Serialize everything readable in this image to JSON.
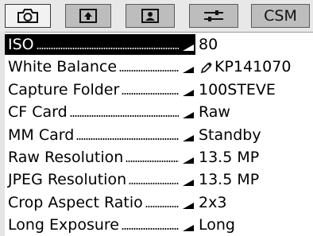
{
  "tabs": [
    {
      "name": "tab-camera",
      "icon": "camera-icon",
      "label": "",
      "active": true
    },
    {
      "name": "tab-upload",
      "icon": "upload-icon",
      "label": "",
      "active": false
    },
    {
      "name": "tab-person",
      "icon": "person-icon",
      "label": "",
      "active": false
    },
    {
      "name": "tab-settings",
      "icon": "sliders-icon",
      "label": "",
      "active": false
    },
    {
      "name": "tab-csm",
      "icon": "",
      "label": "CSM",
      "active": false
    }
  ],
  "menu": {
    "items": [
      {
        "label": "ISO",
        "value": "80",
        "selected": true,
        "value_icon": ""
      },
      {
        "label": "White Balance",
        "value": "KP141070",
        "selected": false,
        "value_icon": "eyedropper-icon"
      },
      {
        "label": "Capture Folder",
        "value": "100STEVE",
        "selected": false,
        "value_icon": ""
      },
      {
        "label": "CF Card",
        "value": "Raw",
        "selected": false,
        "value_icon": ""
      },
      {
        "label": "MM Card",
        "value": "Standby",
        "selected": false,
        "value_icon": ""
      },
      {
        "label": "Raw Resolution",
        "value": "13.5 MP",
        "selected": false,
        "value_icon": ""
      },
      {
        "label": "JPEG Resolution",
        "value": "13.5 MP",
        "selected": false,
        "value_icon": ""
      },
      {
        "label": "Crop Aspect Ratio",
        "value": "2x3",
        "selected": false,
        "value_icon": ""
      },
      {
        "label": "Long Exposure",
        "value": "Long",
        "selected": false,
        "value_icon": ""
      }
    ]
  },
  "colors": {
    "selection_bg": "#000000",
    "selection_fg": "#ffffff",
    "tab_inactive": "#bdbdbd",
    "tab_active": "#f2f2f2"
  }
}
